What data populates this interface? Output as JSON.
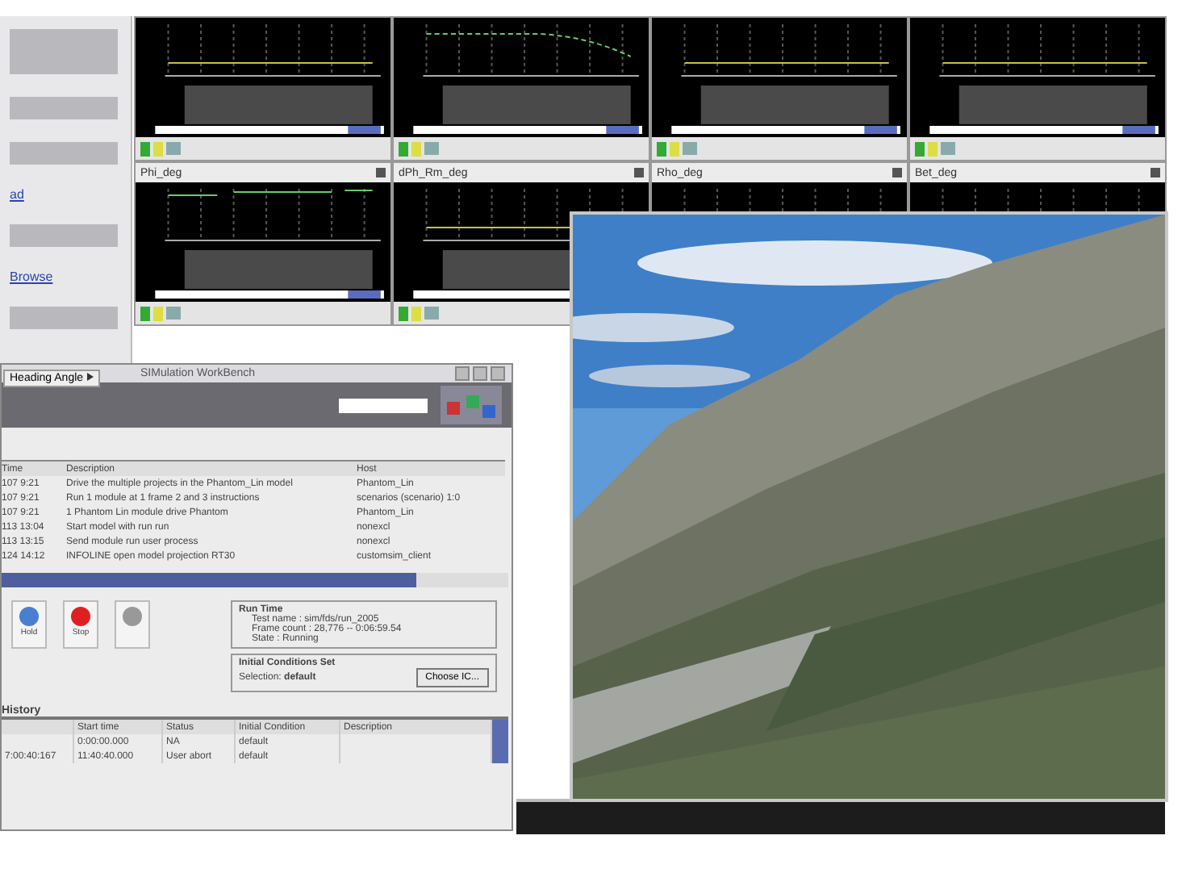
{
  "left_panel": {
    "links": [
      "ad",
      "Browse"
    ],
    "dropdown": "Heading Angle"
  },
  "plots": [
    {
      "kind": "flat"
    },
    {
      "kind": "ramp"
    },
    {
      "kind": "flat"
    },
    {
      "kind": "flat"
    },
    {
      "title": "Phi_deg",
      "kind": "steps"
    },
    {
      "title": "dPh_Rm_deg",
      "kind": "flat"
    },
    {
      "title": "Rho_deg",
      "kind": "partial"
    },
    {
      "title": "Bet_deg",
      "kind": "partial"
    }
  ],
  "workbench": {
    "title": "SIMulation WorkBench",
    "log": {
      "columns": [
        "Time",
        "Description",
        "Host"
      ],
      "rows": [
        [
          "107 9:21",
          "Drive the multiple projects in the Phantom_Lin model",
          "Phantom_Lin"
        ],
        [
          "107 9:21",
          "Run 1 module at 1 frame 2 and 3 instructions",
          "scenarios (scenario) 1:0"
        ],
        [
          "107 9:21",
          "1 Phantom Lin module drive Phantom",
          "Phantom_Lin"
        ],
        [
          "113 13:04",
          "Start model with run run",
          "nonexcl"
        ],
        [
          "113 13:15",
          "Send module run user process",
          "nonexcl"
        ],
        [
          "124 14:12",
          "INFOLINE open model projection RT30",
          "customsim_client"
        ]
      ]
    },
    "buttons": [
      {
        "label": "Hold",
        "kind": "hold"
      },
      {
        "label": "Stop",
        "kind": "stop"
      },
      {
        "kind": "idle"
      }
    ],
    "progress": {
      "level": 0.82
    },
    "run_time": {
      "title": "Run Time",
      "fields": [
        "Test name : sim/fds/run_2005",
        "Frame count : 28,776  --  0:06:59.54",
        "State : Running"
      ]
    },
    "ic": {
      "title": "Initial Conditions Set",
      "selection_label": "Selection:",
      "selection": "default",
      "button": "Choose IC..."
    },
    "history": {
      "title": "History",
      "columns": [
        "",
        "Start time",
        "Status",
        "Initial Condition",
        "Description"
      ],
      "rows": [
        [
          "",
          "0:00:00.000",
          "NA",
          "default",
          ""
        ],
        [
          "7:00:40:167",
          "11:40:40.000",
          "User abort",
          "default",
          ""
        ]
      ]
    }
  }
}
